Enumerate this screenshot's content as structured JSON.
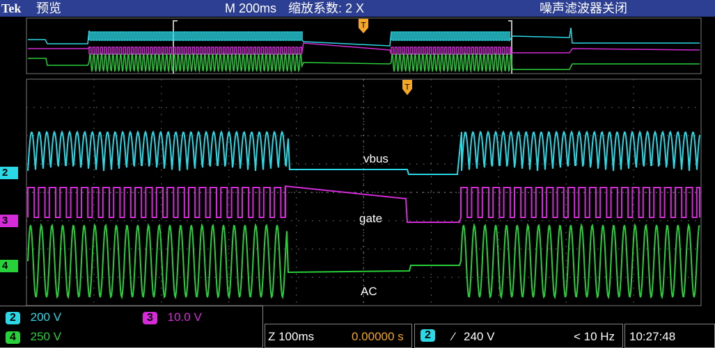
{
  "header": {
    "brand": "Tek",
    "mode": "预览",
    "timebase": "M 200ms",
    "zoom_factor": "缩放系数: 2 X",
    "noise_filter": "噪声滤波器关闭"
  },
  "channels": [
    {
      "id": "2",
      "scale": "200 V",
      "color": "#2bd9e6",
      "label": "vbus"
    },
    {
      "id": "3",
      "scale": "10.0 V",
      "color": "#d62bd9",
      "label": "gate"
    },
    {
      "id": "4",
      "scale": "250 V",
      "color": "#28d03a",
      "label": "AC"
    }
  ],
  "readouts": {
    "zoom_time": "Z 100ms",
    "delay": "0.00000 s",
    "trigger_channel": "2",
    "trigger_slope": "⁄",
    "trigger_level": "240 V",
    "frequency": "< 10 Hz",
    "clock": "10:27:48"
  },
  "colors": {
    "header_bg": "#2c3f93",
    "grid": "#6b6b6b",
    "trigger_marker": "#f5a623"
  }
}
